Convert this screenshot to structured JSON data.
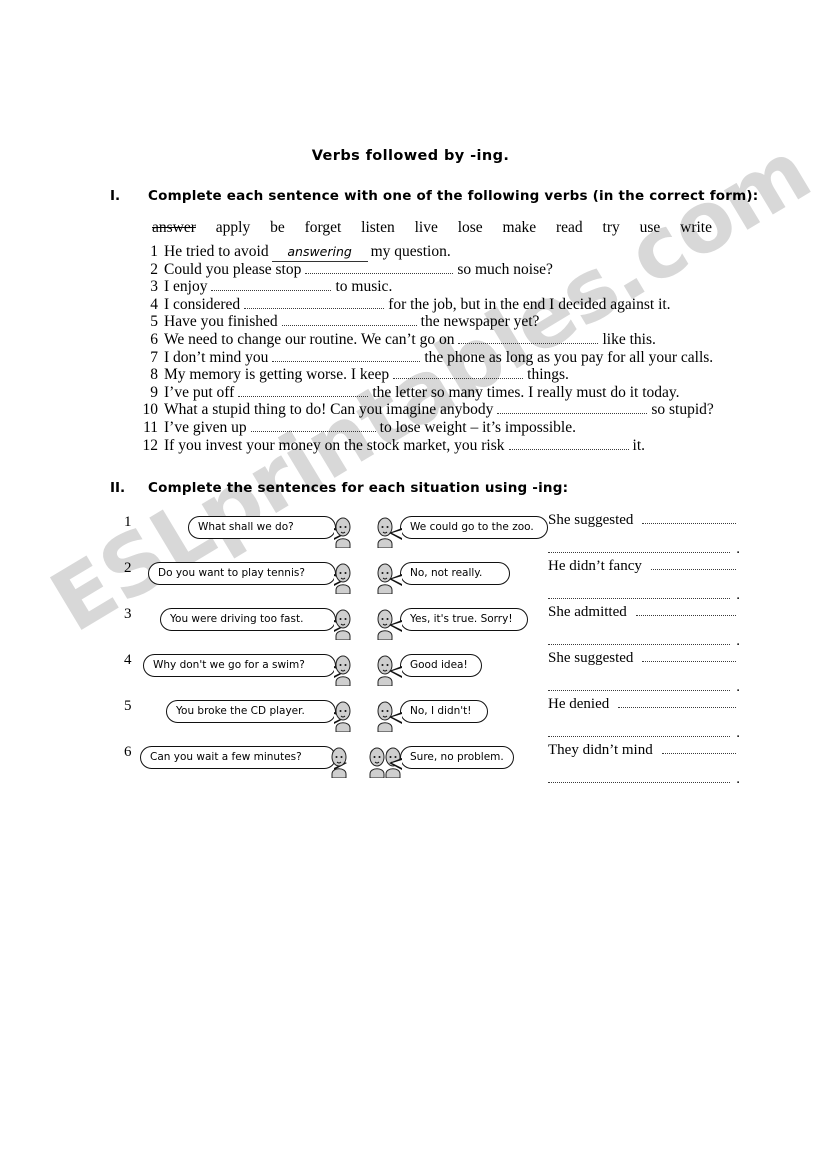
{
  "watermark": {
    "text": "ESLprintables.com"
  },
  "title": "Verbs followed by -ing.",
  "sections": [
    {
      "numeral": "I.",
      "heading": "Complete each sentence with one of the following verbs (in the correct form):"
    },
    {
      "numeral": "II.",
      "heading": "Complete the sentences for each situation using -ing:"
    }
  ],
  "word_bank": [
    {
      "word": "answer",
      "struck": true
    },
    {
      "word": "apply",
      "struck": false
    },
    {
      "word": "be",
      "struck": false
    },
    {
      "word": "forget",
      "struck": false
    },
    {
      "word": "listen",
      "struck": false
    },
    {
      "word": "live",
      "struck": false
    },
    {
      "word": "lose",
      "struck": false
    },
    {
      "word": "make",
      "struck": false
    },
    {
      "word": "read",
      "struck": false
    },
    {
      "word": "try",
      "struck": false
    },
    {
      "word": "use",
      "struck": false
    },
    {
      "word": "write",
      "struck": false
    }
  ],
  "exercise1": [
    {
      "num": "1",
      "before": "He tried to avoid",
      "answer": "answering",
      "after": "my question."
    },
    {
      "num": "2",
      "before": "Could you please stop",
      "answer": "",
      "after": "so much noise?"
    },
    {
      "num": "3",
      "before": "I enjoy",
      "answer": "",
      "after": "to music."
    },
    {
      "num": "4",
      "before": "I considered",
      "answer": "",
      "after": "for the job, but in the end I decided against it."
    },
    {
      "num": "5",
      "before": "Have you finished",
      "answer": "",
      "after": "the newspaper yet?"
    },
    {
      "num": "6",
      "before": "We need to change our routine. We can’t go on",
      "answer": "",
      "after": "like this."
    },
    {
      "num": "7",
      "before": "I don’t mind you",
      "answer": "",
      "after": "the phone as long as you pay for all your calls."
    },
    {
      "num": "8",
      "before": "My memory is getting worse. I keep",
      "answer": "",
      "after": "things."
    },
    {
      "num": "9",
      "before": "I’ve put off",
      "answer": "",
      "after": "the letter so many times. I really must do it today."
    },
    {
      "num": "10",
      "before": "What a stupid thing to do! Can you imagine anybody",
      "answer": "",
      "after": "so stupid?"
    },
    {
      "num": "11",
      "before": "I’ve given up",
      "answer": "",
      "after": "to lose weight – it’s impossible."
    },
    {
      "num": "12",
      "before": "If you invest your money on the stock market, you risk",
      "answer": "",
      "after": "it."
    }
  ],
  "exercise2": [
    {
      "num": "1",
      "left_bubble": "What shall we do?",
      "right_bubble": "We could go to the zoo.",
      "answer_label": "She suggested",
      "answer_value": ""
    },
    {
      "num": "2",
      "left_bubble": "Do you want to play tennis?",
      "right_bubble": "No, not really.",
      "answer_label": "He didn’t fancy",
      "answer_value": ""
    },
    {
      "num": "3",
      "left_bubble": "You were driving too fast.",
      "right_bubble": "Yes, it's true. Sorry!",
      "answer_label": "She admitted",
      "answer_value": ""
    },
    {
      "num": "4",
      "left_bubble": "Why don't we go for a swim?",
      "right_bubble": "Good idea!",
      "answer_label": "She suggested",
      "answer_value": ""
    },
    {
      "num": "5",
      "left_bubble": "You broke the CD player.",
      "right_bubble": "No, I didn't!",
      "answer_label": "He denied",
      "answer_value": ""
    },
    {
      "num": "6",
      "left_bubble": "Can you wait a few minutes?",
      "right_bubble": "Sure, no problem.",
      "answer_label": "They didn’t mind",
      "answer_value": ""
    }
  ],
  "answer_period": "."
}
